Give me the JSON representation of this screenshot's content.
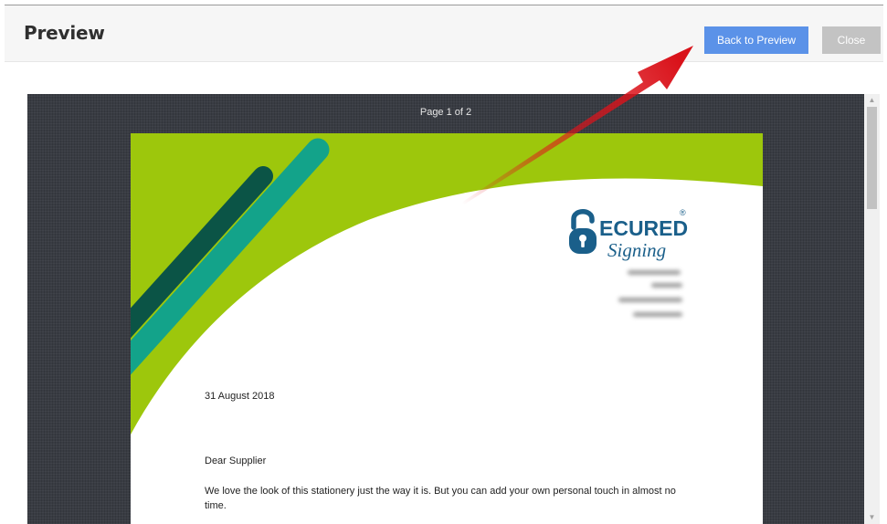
{
  "header": {
    "title": "Preview",
    "back_label": "Back to Preview",
    "close_label": "Close"
  },
  "viewer": {
    "page_indicator": "Page 1 of 2"
  },
  "document": {
    "logo_text_top": "ECURED",
    "logo_text_bottom": "Signing",
    "logo_registered": "®",
    "date": "31 August 2018",
    "salutation": "Dear Supplier",
    "body": "We love the look of this stationery just the way it is. But you can add your own personal touch in almost no time."
  },
  "colors": {
    "accent_button": "#5b92e8",
    "disabled_button": "#c3c3c3",
    "lime_green": "#9dc70c",
    "teal": "#13a38a",
    "dark_teal": "#0b5446",
    "logo_blue": "#1a5f8a",
    "arrow_red": "#e0141c"
  },
  "icons": {
    "scroll_up": "chevron-up-icon",
    "scroll_down": "chevron-down-icon",
    "annotation": "red-arrow-icon"
  }
}
